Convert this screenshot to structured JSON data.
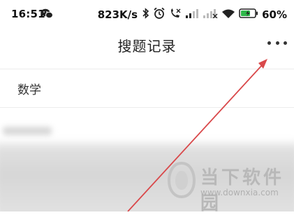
{
  "status_bar": {
    "time": "16:51",
    "net_speed": "823K/s",
    "battery_percent": "60%",
    "icons": [
      "wechat-icon",
      "bluetooth-icon",
      "alarm-icon",
      "no-call-icon",
      "signal-icon",
      "signal-no-sim-icon",
      "wifi-icon",
      "battery-charging-icon"
    ]
  },
  "nav": {
    "title": "搜题记录",
    "more_icon": "more-dots-icon"
  },
  "subject": {
    "label": "数学"
  },
  "watermark": {
    "title": "当下软件园",
    "url": "www.downxia.com"
  },
  "annotation": {
    "arrow_color": "#d9484a",
    "points_to": "more-dots-icon"
  }
}
